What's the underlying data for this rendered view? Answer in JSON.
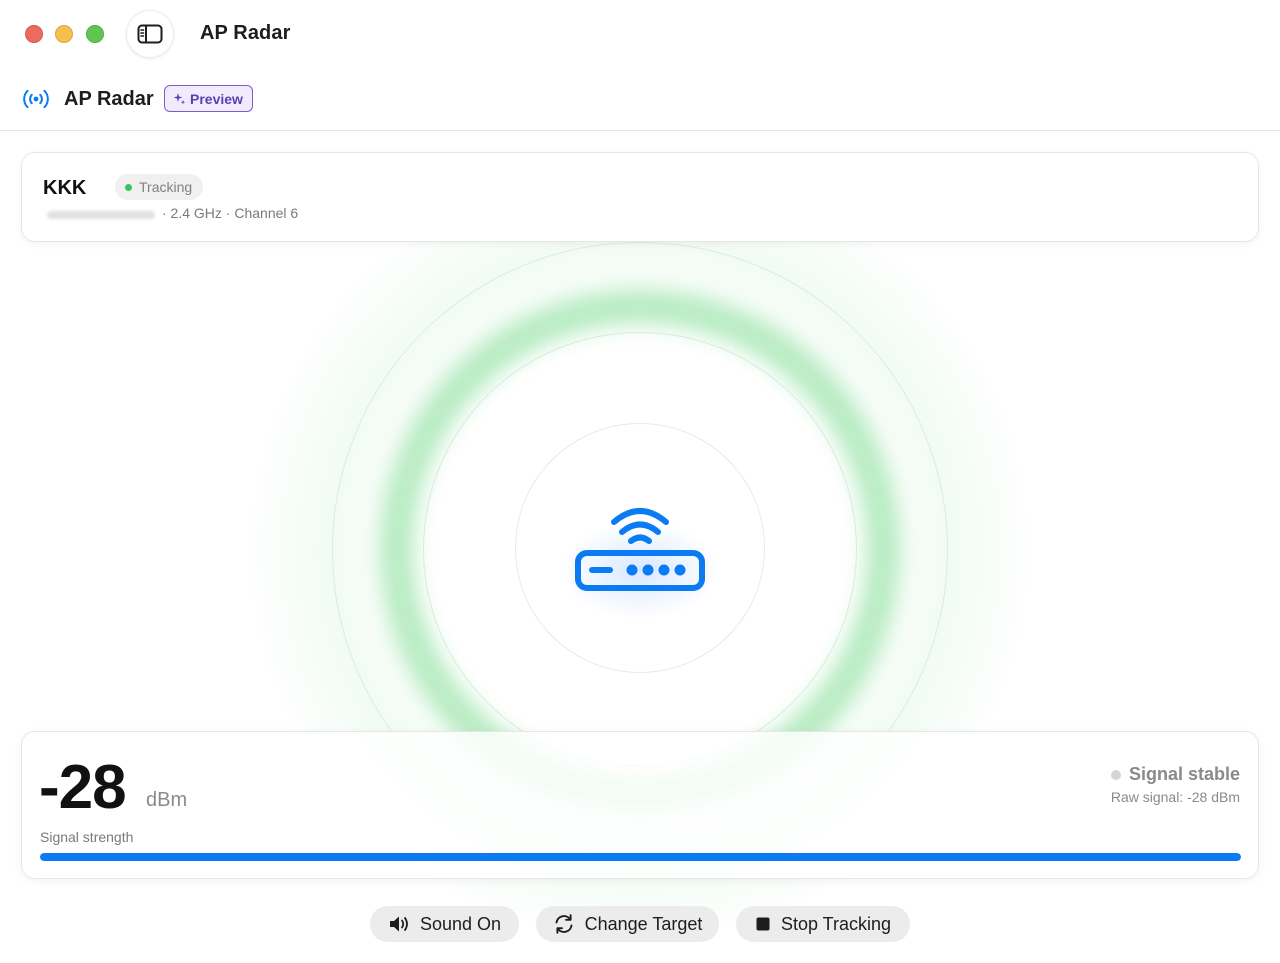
{
  "window": {
    "title": "AP Radar",
    "icons": {
      "sidebar_toggle": "sidebar-toggle-icon"
    }
  },
  "header": {
    "app_name": "AP Radar",
    "badge": "Preview",
    "icons": {
      "app": "radar-antenna-icon",
      "badge": "sparkle-icon"
    },
    "colors": {
      "accent": "#0a7bf2",
      "badge": "#7b5ccc"
    }
  },
  "target": {
    "ssid": "KKK",
    "status": "Tracking",
    "details": "· 2.4 GHz · Channel 6",
    "status_color": "#34c759"
  },
  "radar": {
    "icon": "wifi-router-icon",
    "glow_color": "#7ddc91"
  },
  "signal": {
    "value": "-28",
    "unit": "dBm",
    "label": "Signal strength",
    "status": "Signal stable",
    "raw": "Raw signal: -28 dBm",
    "strength_fraction": 1.0
  },
  "actions": {
    "sound": {
      "label": "Sound On",
      "icon": "speaker-icon"
    },
    "change": {
      "label": "Change Target",
      "icon": "refresh-icon"
    },
    "stop": {
      "label": "Stop Tracking",
      "icon": "stop-icon"
    }
  }
}
